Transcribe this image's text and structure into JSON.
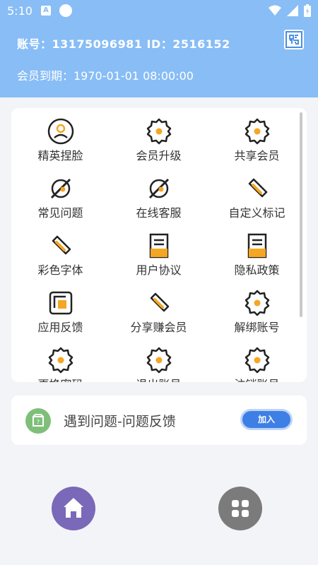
{
  "status": {
    "time": "5:10",
    "notif": "A"
  },
  "header": {
    "account": "账号：13175096981  ID：2516152",
    "member_expire": "会员到期：1970-01-01 08:00:00"
  },
  "grid": [
    {
      "label": "精英捏脸",
      "icon": "user-circle-icon"
    },
    {
      "label": "会员升级",
      "icon": "gear-icon"
    },
    {
      "label": "共享会员",
      "icon": "gear-icon"
    },
    {
      "label": "常见问题",
      "icon": "planet-icon"
    },
    {
      "label": "在线客服",
      "icon": "planet-icon"
    },
    {
      "label": "自定义标记",
      "icon": "link-icon"
    },
    {
      "label": "彩色字体",
      "icon": "link-icon"
    },
    {
      "label": "用户协议",
      "icon": "document-icon"
    },
    {
      "label": "隐私政策",
      "icon": "document-icon"
    },
    {
      "label": "应用反馈",
      "icon": "copy-icon"
    },
    {
      "label": "分享赚会员",
      "icon": "link-icon"
    },
    {
      "label": "解绑账号",
      "icon": "gear-icon"
    },
    {
      "label": "更换密码",
      "icon": "gear-icon"
    },
    {
      "label": "退出账号",
      "icon": "gear-icon"
    },
    {
      "label": "注销账号",
      "icon": "gear-icon"
    }
  ],
  "feedback": {
    "text": "遇到问题-问题反馈",
    "button": "加入",
    "icon": "package-icon"
  },
  "nav": {
    "home_icon": "home-icon",
    "apps_icon": "apps-icon"
  },
  "colors": {
    "header": "#88bdf6",
    "accent": "#f5a623",
    "button": "#3e7fe6",
    "home": "#7a68b8"
  }
}
